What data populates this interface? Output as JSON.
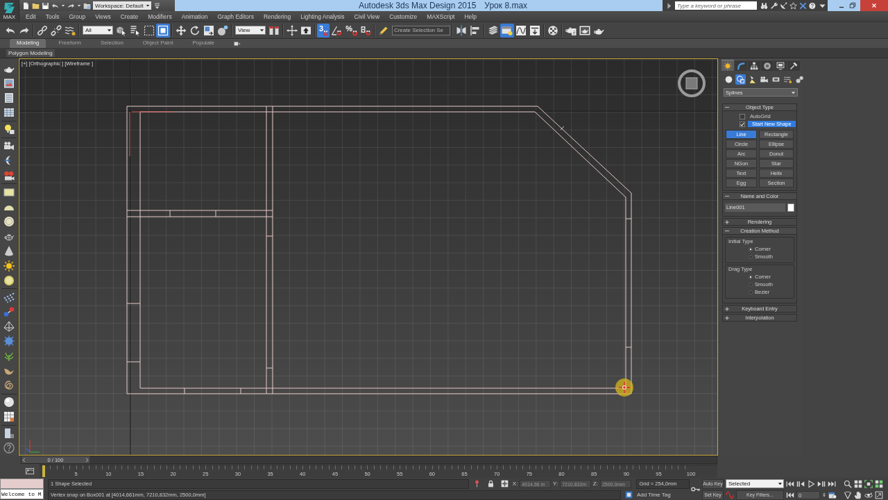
{
  "title_bar": {
    "app_logo_label": "MAX",
    "workspace": "Workspace: Default",
    "title": "Autodesk 3ds Max Design 2015",
    "file_name": "Урок 8.max",
    "search": {
      "placeholder": "Type a keyword or phrase"
    }
  },
  "menu_bar": [
    "Edit",
    "Tools",
    "Group",
    "Views",
    "Create",
    "Modifiers",
    "Animation",
    "Graph Editors",
    "Rendering",
    "Lighting Analysis",
    "Civil View",
    "Customize",
    "MAXScript",
    "Help"
  ],
  "main_toolbar": [
    [
      {
        "kind": "undo",
        "active": false
      },
      {
        "kind": "redo",
        "active": false
      }
    ],
    [
      {
        "kind": "link",
        "active": false
      },
      {
        "kind": "unlink",
        "active": false
      },
      {
        "kind": "bind",
        "active": false
      }
    ],
    [
      {
        "kind": "dropdown",
        "value": "All"
      },
      {
        "kind": "select",
        "active": false
      },
      {
        "kind": "select_by_name",
        "active": false
      },
      {
        "kind": "region",
        "active": false
      },
      {
        "kind": "crossing",
        "active": true
      }
    ],
    [
      {
        "kind": "move",
        "active": false
      },
      {
        "kind": "rotate",
        "active": false
      },
      {
        "kind": "scale",
        "active": false
      },
      {
        "kind": "place",
        "active": false
      }
    ],
    [
      {
        "kind": "dropdown",
        "value": "View"
      },
      {
        "kind": "pivot",
        "active": false
      }
    ],
    [
      {
        "kind": "manipulate",
        "active": false
      },
      {
        "kind": "keyboard",
        "active": false
      }
    ],
    [
      {
        "kind": "snap",
        "label": "3",
        "active": true
      },
      {
        "kind": "angle_snap",
        "active": false
      },
      {
        "kind": "percent_snap",
        "label": "%",
        "active": false
      },
      {
        "kind": "spinner_snap",
        "active": false
      }
    ],
    [
      {
        "kind": "edit_sets",
        "active": false
      },
      {
        "kind": "field",
        "placeholder": "Create Selection Se"
      }
    ],
    [
      {
        "kind": "mirror",
        "active": false
      },
      {
        "kind": "align",
        "active": false
      }
    ],
    [
      {
        "kind": "layers",
        "active": false
      },
      {
        "kind": "ribbon",
        "active": true
      },
      {
        "kind": "curve_editor",
        "active": false
      },
      {
        "kind": "schematic",
        "active": false
      }
    ],
    [
      {
        "kind": "material",
        "active": false
      }
    ],
    [
      {
        "kind": "render_setup",
        "active": false
      },
      {
        "kind": "frame_window",
        "active": false
      },
      {
        "kind": "render",
        "active": false
      }
    ]
  ],
  "ribbon": {
    "tabs": [
      {
        "label": "Modeling",
        "selected": true
      },
      {
        "label": "Freeform",
        "selected": false
      },
      {
        "label": "Selection",
        "selected": false
      },
      {
        "label": "Object Paint",
        "selected": false
      },
      {
        "label": "Populate",
        "selected": false
      }
    ],
    "panel": "Polygon Modeling"
  },
  "viewport": {
    "active": true,
    "labels": [
      "[+]",
      "[Orthographic ]",
      "[Wireframe ]"
    ]
  },
  "command_panel": {
    "tabs": [
      {
        "kind": "create",
        "selected": true
      },
      {
        "kind": "modify",
        "selected": false
      },
      {
        "kind": "hierarchy",
        "selected": false
      },
      {
        "kind": "motion",
        "selected": false
      },
      {
        "kind": "display",
        "selected": false
      },
      {
        "kind": "utilities",
        "selected": false
      }
    ],
    "categories": [
      {
        "kind": "geometry",
        "selected": false
      },
      {
        "kind": "shapes",
        "selected": true
      },
      {
        "kind": "lights",
        "selected": false
      },
      {
        "kind": "cameras",
        "selected": false
      },
      {
        "kind": "helpers",
        "selected": false
      },
      {
        "kind": "spacewarps",
        "selected": false
      },
      {
        "kind": "systems",
        "selected": false
      }
    ],
    "category_dropdown": "Splines",
    "rollouts": [
      {
        "kind": "object_type",
        "title": "Object Type",
        "expanded": true,
        "checkboxes": [
          {
            "label": "AutoGrid",
            "checked": false,
            "focused": false
          },
          {
            "label": "Start New Shape",
            "checked": true,
            "focused": true
          }
        ],
        "buttons": [
          {
            "label": "Line",
            "selected": true
          },
          {
            "label": "Rectangle",
            "selected": false
          },
          {
            "label": "Circle",
            "selected": false
          },
          {
            "label": "Ellipse",
            "selected": false
          },
          {
            "label": "Arc",
            "selected": false
          },
          {
            "label": "Donut",
            "selected": false
          },
          {
            "label": "NGon",
            "selected": false
          },
          {
            "label": "Star",
            "selected": false
          },
          {
            "label": "Text",
            "selected": false
          },
          {
            "label": "Helix",
            "selected": false
          },
          {
            "label": "Egg",
            "selected": false
          },
          {
            "label": "Section",
            "selected": false
          }
        ]
      },
      {
        "kind": "name_color",
        "title": "Name and Color",
        "expanded": true,
        "name": "Line001",
        "color": "#ffffff"
      },
      {
        "kind": "plain",
        "title": "Rendering",
        "expanded": false
      },
      {
        "kind": "creation_method",
        "title": "Creation Method",
        "expanded": true,
        "groups": [
          {
            "title": "Initial Type",
            "options": [
              {
                "label": "Corner",
                "selected": true
              },
              {
                "label": "Smooth",
                "selected": false
              }
            ]
          },
          {
            "title": "Drag Type",
            "options": [
              {
                "label": "Corner",
                "selected": true
              },
              {
                "label": "Smooth",
                "selected": false
              },
              {
                "label": "Bezier",
                "selected": false
              }
            ]
          }
        ]
      },
      {
        "kind": "plain",
        "title": "Keyboard Entry",
        "expanded": false
      },
      {
        "kind": "plain",
        "title": "Interpolation",
        "expanded": false
      }
    ]
  },
  "timeline": {
    "time_slider": {
      "label": "0 / 100",
      "level": 0
    },
    "frame_labels": [
      "5",
      "10",
      "15",
      "20",
      "25",
      "30",
      "35",
      "40",
      "45",
      "50",
      "55",
      "60",
      "65",
      "70",
      "75",
      "80",
      "85",
      "90",
      "95",
      "100"
    ]
  },
  "status_bar": {
    "listener_output": "Welcome to M",
    "selection_info": "1 Shape Selected",
    "prompt": "Vertex snap on Box001 at [4014,661mm, 7210,832mm, 2500,0mm]",
    "coordinates": [
      {
        "label": "X:",
        "value": "4014,66 m",
        "disabled": true
      },
      {
        "label": "Y:",
        "value": "7210,832m",
        "disabled": true
      },
      {
        "label": "Z:",
        "value": "2500,0mm",
        "disabled": true
      }
    ],
    "grid": "Grid = 254,0mm",
    "time_tag": "Add Time Tag"
  },
  "animation_controls": {
    "auto_key": "Auto Key",
    "key_set": "Selected",
    "set_key": "Set Key",
    "key_filters": "Key Filters...",
    "frame": "0"
  }
}
